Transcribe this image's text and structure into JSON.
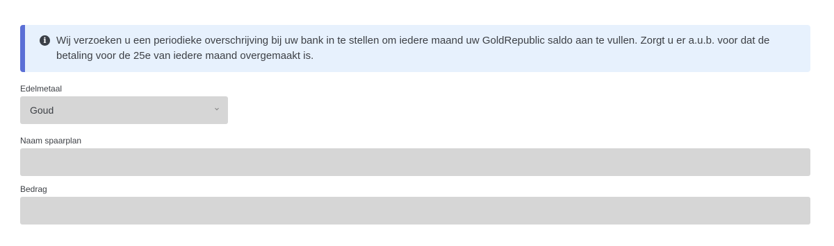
{
  "notice": {
    "icon": "info-circle-icon",
    "text": "Wij verzoeken u een periodieke overschrijving bij uw bank in te stellen om iedere maand uw GoldRepublic saldo aan te vullen. Zorgt u er a.u.b. voor dat de betaling voor de 25e van iedere maand overgemaakt is."
  },
  "form": {
    "metal_label": "Edelmetaal",
    "metal_value": "Goud",
    "plan_name_label": "Naam spaarplan",
    "plan_name_value": "",
    "amount_label": "Bedrag",
    "amount_value": ""
  },
  "colors": {
    "notice_background": "#e7f1fd",
    "notice_border": "#5b6fd6",
    "field_background": "#d6d6d6"
  }
}
